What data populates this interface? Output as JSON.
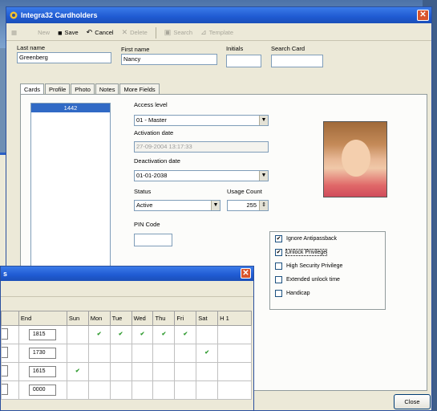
{
  "window": {
    "title": "Integra32 Cardholders",
    "close_glyph": "✕"
  },
  "toolbar": {
    "new": "New",
    "save": "Save",
    "cancel": "Cancel",
    "delete": "Delete",
    "search": "Search",
    "template": "Template"
  },
  "fields": {
    "last_name_label": "Last name",
    "last_name": "Greenberg",
    "first_name_label": "First name",
    "first_name": "Nancy",
    "initials_label": "Initials",
    "initials": "",
    "search_card_label": "Search Card",
    "search_card": ""
  },
  "tabs": [
    "Cards",
    "Profile",
    "Photo",
    "Notes",
    "More Fields"
  ],
  "cards_list": [
    "1442"
  ],
  "card": {
    "access_level_label": "Access level",
    "access_level": "01 - Master",
    "activation_label": "Activation date",
    "activation": "27-09-2004 13:17:33",
    "deactivation_label": "Deactivation date",
    "deactivation": "01-01-2038",
    "status_label": "Status",
    "status": "Active",
    "usage_label": "Usage Count",
    "usage": "255",
    "pin_label": "PIN Code",
    "pin": ""
  },
  "options": [
    {
      "label": "Ignore Antipassback",
      "checked": true
    },
    {
      "label": "Unlock Privilege",
      "checked": true
    },
    {
      "label": "High Security Privilege",
      "checked": false
    },
    {
      "label": "Extended unlock time",
      "checked": false
    },
    {
      "label": "Handicap",
      "checked": false
    }
  ],
  "close_button": "Close",
  "schedule": {
    "title_fragment": "s",
    "columns": [
      "End",
      "Sun",
      "Mon",
      "Tue",
      "Wed",
      "Thu",
      "Fri",
      "Sat",
      "H 1"
    ],
    "rows": [
      {
        "end": "1815",
        "days": [
          false,
          true,
          true,
          true,
          true,
          true,
          false,
          false
        ]
      },
      {
        "end": "1730",
        "days": [
          false,
          false,
          false,
          false,
          false,
          false,
          true,
          false
        ]
      },
      {
        "end": "1615",
        "days": [
          true,
          false,
          false,
          false,
          false,
          false,
          false,
          false
        ]
      },
      {
        "end": "0000",
        "days": [
          false,
          false,
          false,
          false,
          false,
          false,
          false,
          false
        ]
      }
    ],
    "tick_glyph": "✔"
  },
  "colors": {
    "titlebar": "#1f5ad2",
    "close": "#d9542c",
    "tick": "#2e9a2e",
    "selection": "#316ac5"
  }
}
